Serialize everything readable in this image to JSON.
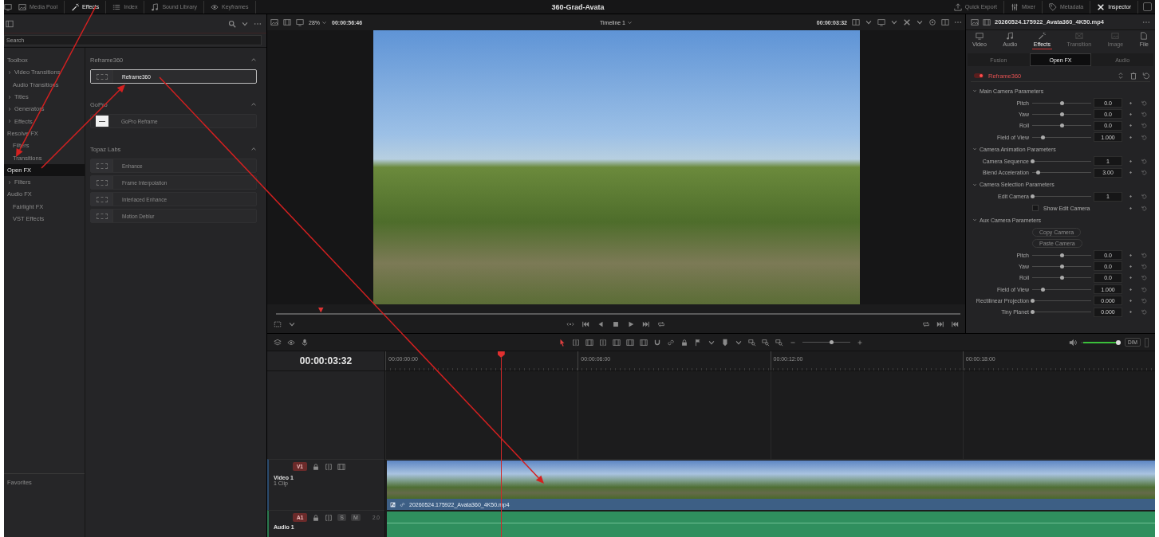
{
  "top_bar": {
    "left_tabs": [
      {
        "label": "Media Pool",
        "selected": false
      },
      {
        "label": "Effects",
        "selected": true
      },
      {
        "label": "Index",
        "selected": false
      },
      {
        "label": "Sound Library",
        "selected": false
      },
      {
        "label": "Keyframes",
        "selected": false
      }
    ],
    "title": "360-Grad-Avata",
    "right_tabs": [
      {
        "label": "Quick Export",
        "selected": false
      },
      {
        "label": "Mixer",
        "selected": false
      },
      {
        "label": "Metadata",
        "selected": false
      },
      {
        "label": "Inspector",
        "selected": true
      }
    ]
  },
  "effects_library": {
    "search": {
      "placeholder": "Search"
    },
    "tree": [
      {
        "label": "Toolbox",
        "selected": false,
        "expandable": false,
        "children": [
          {
            "label": "Video Transitions",
            "selected": false,
            "expandable": true
          },
          {
            "label": "Audio Transitions",
            "selected": false,
            "expandable": false
          },
          {
            "label": "Titles",
            "selected": false,
            "expandable": true
          },
          {
            "label": "Generators",
            "selected": false,
            "expandable": true
          },
          {
            "label": "Effects",
            "selected": false,
            "expandable": true
          }
        ]
      },
      {
        "label": "Resolve FX",
        "selected": false,
        "expandable": false,
        "children": [
          {
            "label": "Filters",
            "selected": false,
            "expandable": false
          },
          {
            "label": "Transitions",
            "selected": false,
            "expandable": false
          }
        ]
      },
      {
        "label": "Open FX",
        "selected": true,
        "expandable": false,
        "children": [
          {
            "label": "Filters",
            "selected": false,
            "expandable": true
          }
        ]
      },
      {
        "label": "Audio FX",
        "selected": false,
        "expandable": false,
        "children": [
          {
            "label": "Fairlight FX",
            "selected": false,
            "expandable": false
          },
          {
            "label": "VST Effects",
            "selected": false,
            "expandable": false
          }
        ]
      }
    ],
    "favorites": "Favorites",
    "groups": [
      {
        "title": "Reframe360",
        "expanded": true,
        "items": [
          {
            "label": "Reframe360",
            "kind": "generic",
            "selected": true
          }
        ]
      },
      {
        "title": "GoPro",
        "expanded": true,
        "items": [
          {
            "label": "GoPro Reframe",
            "kind": "logo",
            "selected": false
          }
        ]
      },
      {
        "title": "Topaz Labs",
        "expanded": true,
        "items": [
          {
            "label": "Enhance",
            "kind": "generic",
            "selected": false
          },
          {
            "label": "Frame Interpolation",
            "kind": "generic",
            "selected": false
          },
          {
            "label": "Interlaced Enhance",
            "kind": "generic",
            "selected": false
          },
          {
            "label": "Motion Deblur",
            "kind": "generic",
            "selected": false
          }
        ]
      }
    ]
  },
  "viewer": {
    "zoom": "28%",
    "duration": "00:00:56:46",
    "timeline_name": "Timeline 1",
    "timecode": "00:00:03:32",
    "scrubber": {
      "level": 0.065
    }
  },
  "inspector": {
    "clip_name": "20260524.175922_Avata360_4K50.mp4",
    "tabs": [
      {
        "label": "Video",
        "selected": false,
        "disabled": false
      },
      {
        "label": "Audio",
        "selected": false,
        "disabled": false
      },
      {
        "label": "Effects",
        "selected": true,
        "disabled": false
      },
      {
        "label": "Transition",
        "selected": false,
        "disabled": true
      },
      {
        "label": "Image",
        "selected": false,
        "disabled": true
      },
      {
        "label": "File",
        "selected": false,
        "disabled": false
      }
    ],
    "subtabs": [
      {
        "label": "Fusion",
        "selected": false,
        "disabled": true
      },
      {
        "label": "Open FX",
        "selected": true,
        "disabled": false
      },
      {
        "label": "Audio",
        "selected": false,
        "disabled": true
      }
    ],
    "effect": {
      "name": "Reframe360",
      "enabled": true
    },
    "sections": [
      {
        "title": "Main Camera Parameters",
        "expanded": true,
        "rows": [
          {
            "kind": "slider",
            "label": "Pitch",
            "level": 0.5,
            "value": "0.0"
          },
          {
            "kind": "slider",
            "label": "Yaw",
            "level": 0.5,
            "value": "0.0"
          },
          {
            "kind": "slider",
            "label": "Roll",
            "level": 0.5,
            "value": "0.0"
          },
          {
            "kind": "slider",
            "label": "Field of View",
            "level": 0.17,
            "value": "1.000"
          }
        ]
      },
      {
        "title": "Camera Animation Parameters",
        "expanded": true,
        "rows": [
          {
            "kind": "slider",
            "label": "Camera Sequence",
            "level": 0.0,
            "value": "1"
          },
          {
            "kind": "slider",
            "label": "Blend Acceleration",
            "level": 0.1,
            "value": "3.00"
          }
        ]
      },
      {
        "title": "Camera Selection Parameters",
        "expanded": true,
        "rows": [
          {
            "kind": "slider",
            "label": "Edit Camera",
            "level": 0.0,
            "value": "1"
          },
          {
            "kind": "checkbox",
            "label": "Show Edit Camera",
            "checked": false
          }
        ]
      },
      {
        "title": "Aux Camera Parameters",
        "expanded": true,
        "rows": [
          {
            "kind": "button",
            "label": "Copy Camera"
          },
          {
            "kind": "button",
            "label": "Paste Camera"
          },
          {
            "kind": "slider",
            "label": "Pitch",
            "level": 0.5,
            "value": "0.0"
          },
          {
            "kind": "slider",
            "label": "Yaw",
            "level": 0.5,
            "value": "0.0"
          },
          {
            "kind": "slider",
            "label": "Roll",
            "level": 0.5,
            "value": "0.0"
          },
          {
            "kind": "slider",
            "label": "Field of View",
            "level": 0.17,
            "value": "1.000"
          },
          {
            "kind": "slider",
            "label": "Rectilinear Projection",
            "level": 0.0,
            "value": "0.000"
          },
          {
            "kind": "slider",
            "label": "Tiny Planet",
            "level": 0.0,
            "value": "0.000"
          }
        ]
      }
    ]
  },
  "timeline": {
    "timecode": "00:00:03:32",
    "ruler": [
      "00:00:00:00",
      "00:00:06:00",
      "00:00:12:00",
      "00:00:18:00"
    ],
    "playhead": {
      "level": 0.15
    },
    "zoom_slider": {
      "level": 0.6
    },
    "volume": {
      "level": 1
    },
    "dim": "DIM",
    "tracks": [
      {
        "kind": "video",
        "badge": "V1",
        "name": "Video 1",
        "info": "1 Clip",
        "clip": "20260524.175922_Avata360_4K50.mp4"
      },
      {
        "kind": "audio",
        "badge": "A1",
        "name": "Audio 1",
        "solo": "S",
        "mute": "M",
        "channels": "2.0"
      }
    ]
  }
}
